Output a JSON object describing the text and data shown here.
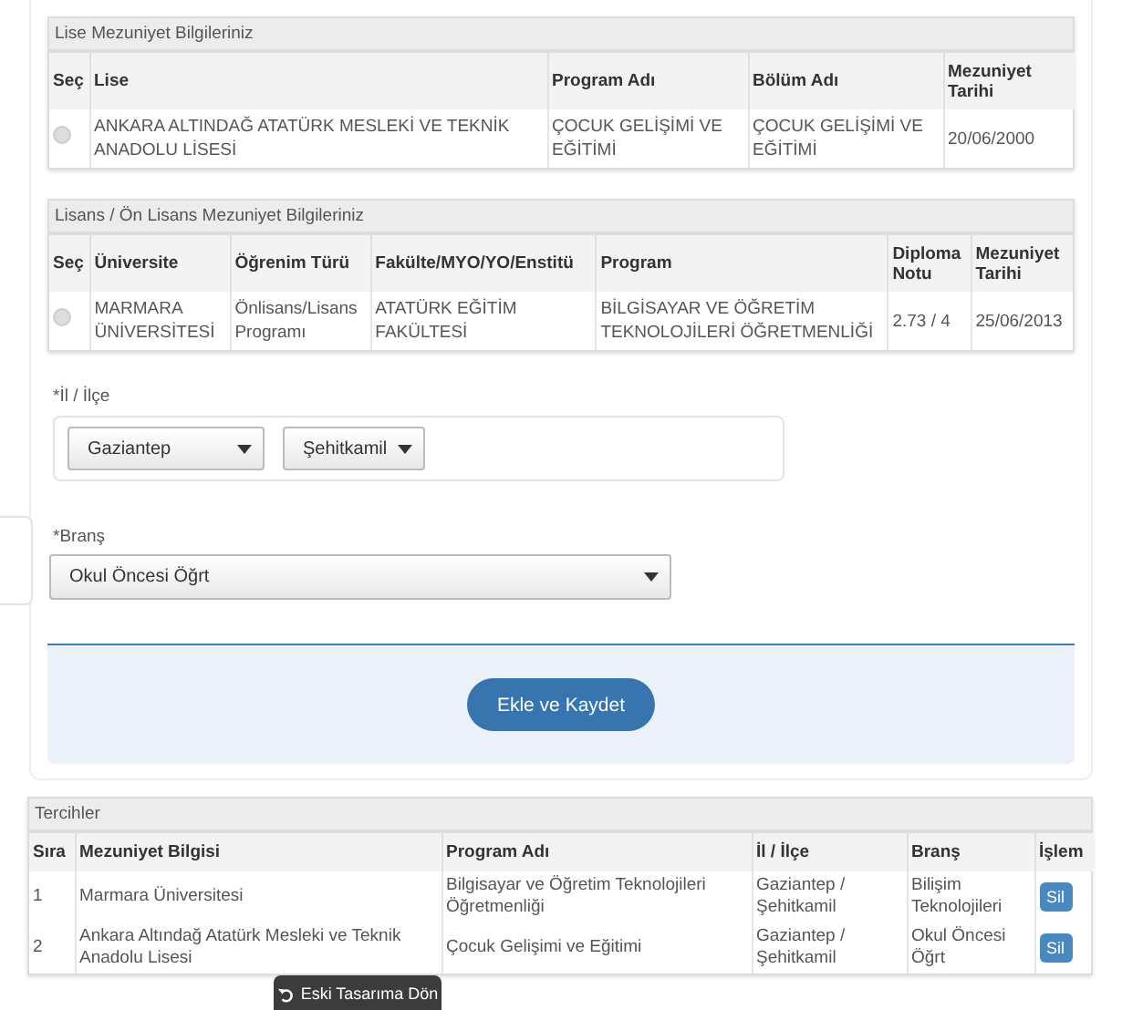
{
  "lise": {
    "title": "Lise Mezuniyet Bilgileriniz",
    "select_column": "Seç",
    "columns": [
      "Lise",
      "Program Adı",
      "Bölüm Adı",
      "Mezuniyet Tarihi"
    ],
    "rows": [
      {
        "selected": false,
        "cells": [
          "ANKARA ALTINDAĞ ATATÜRK MESLEKİ VE TEKNİK ANADOLU LİSESİ",
          "ÇOCUK GELİŞİMİ VE EĞİTİMİ",
          "ÇOCUK GELİŞİMİ VE EĞİTİMİ",
          "20/06/2000"
        ]
      }
    ]
  },
  "lisans": {
    "title": "Lisans / Ön Lisans Mezuniyet Bilgileriniz",
    "select_column": "Seç",
    "columns": [
      "Üniversite",
      "Öğrenim Türü",
      "Fakülte/MYO/YO/Enstitü",
      "Program",
      "Diploma Notu",
      "Mezuniyet Tarihi"
    ],
    "rows": [
      {
        "selected": false,
        "cells": [
          "MARMARA ÜNİVERSİTESİ",
          "Önlisans/Lisans Programı",
          "ATATÜRK EĞİTİM FAKÜLTESİ",
          "BİLGİSAYAR VE ÖĞRETİM TEKNOLOJİLERİ ÖĞRETMENLİĞİ",
          "2.73 / 4",
          "25/06/2013"
        ]
      }
    ]
  },
  "il_ilce": {
    "label": "*İl / İlçe",
    "selects": [
      "Gaziantep",
      "Şehitkamil"
    ]
  },
  "brans": {
    "label": "*Branş",
    "value": "Okul Öncesi Öğrt"
  },
  "save_button": "Ekle ve Kaydet",
  "tercihler": {
    "title": "Tercihler",
    "columns": [
      "Sıra",
      "Mezuniyet Bilgisi",
      "Program Adı",
      "İl / İlçe",
      "Branş",
      "İşlem"
    ],
    "rows": [
      {
        "cells": [
          "1",
          "Marmara Üniversitesi",
          "Bilgisayar ve Öğretim Teknolojileri Öğretmenliği",
          "Gaziantep / Şehitkamil",
          "Bilişim Teknolojileri"
        ],
        "action": "Sil"
      },
      {
        "cells": [
          "2",
          "Ankara Altındağ Atatürk Mesleki ve Teknik Anadolu Lisesi",
          "Çocuk Gelişimi ve Eğitimi",
          "Gaziantep / Şehitkamil",
          "Okul Öncesi Öğrt"
        ],
        "action": "Sil"
      }
    ]
  },
  "floating_button": "Eski Tasarıma Dön"
}
